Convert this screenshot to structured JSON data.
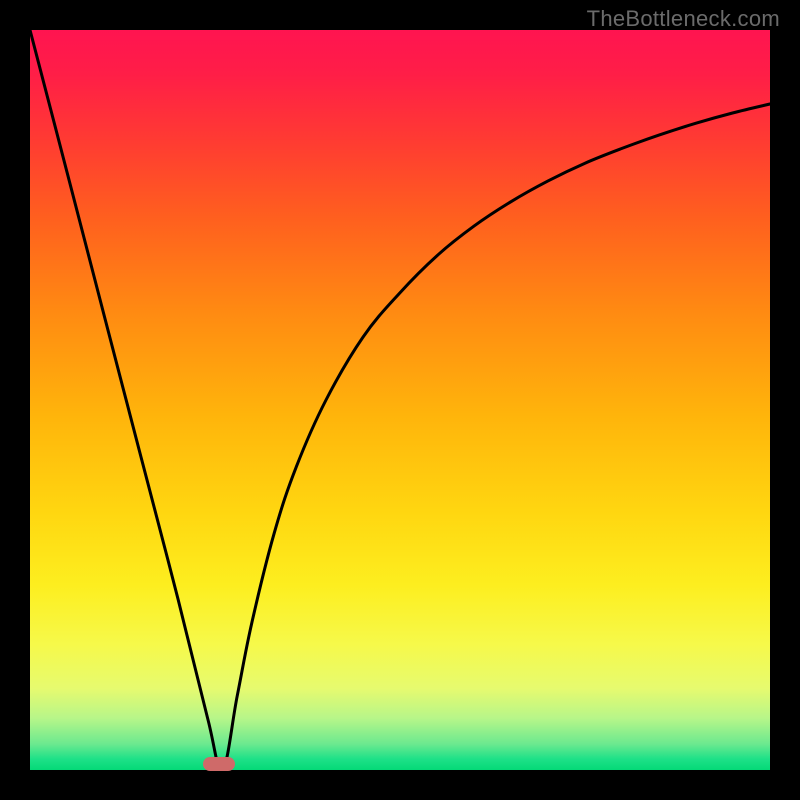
{
  "watermark": "TheBottleneck.com",
  "colors": {
    "frame": "#000000",
    "gradient_top": "#ff1450",
    "gradient_bottom": "#04d977",
    "curve": "#000000",
    "marker": "#cf6a69"
  },
  "chart_data": {
    "type": "line",
    "title": "",
    "xlabel": "",
    "ylabel": "",
    "xlim": [
      0,
      100
    ],
    "ylim": [
      0,
      100
    ],
    "series": [
      {
        "name": "left-branch",
        "x": [
          0,
          5,
          10,
          15,
          20,
          24,
          26
        ],
        "values": [
          100,
          80.8,
          61.5,
          42.3,
          23.1,
          7.0,
          0
        ]
      },
      {
        "name": "right-branch",
        "x": [
          26,
          28,
          30,
          33,
          36,
          40,
          45,
          50,
          55,
          60,
          65,
          70,
          75,
          80,
          85,
          90,
          95,
          100
        ],
        "values": [
          0,
          10,
          20,
          32,
          41,
          50,
          58.5,
          64.5,
          69.5,
          73.5,
          76.8,
          79.6,
          82,
          84,
          85.8,
          87.4,
          88.8,
          90
        ]
      }
    ],
    "marker": {
      "x": 25.5,
      "y": 0.8
    }
  }
}
